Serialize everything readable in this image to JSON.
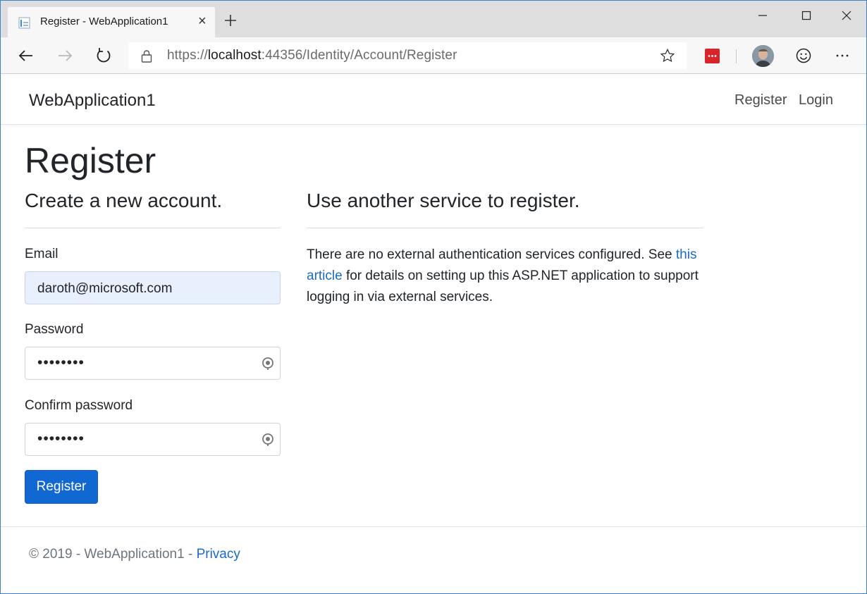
{
  "browser": {
    "tab_title": "Register - WebApplication1",
    "url_prefix": "https://",
    "url_host": "localhost",
    "url_path": ":44356/Identity/Account/Register"
  },
  "header": {
    "brand": "WebApplication1",
    "nav": {
      "register": "Register",
      "login": "Login"
    }
  },
  "main": {
    "title": "Register",
    "form": {
      "heading": "Create a new account.",
      "email_label": "Email",
      "email_value": "daroth@microsoft.com",
      "password_label": "Password",
      "password_value": "••••••••",
      "confirm_label": "Confirm password",
      "confirm_value": "••••••••",
      "submit_label": "Register"
    },
    "external": {
      "heading": "Use another service to register.",
      "text_before": "There are no external authentication services configured. See ",
      "link_text": "this article",
      "text_after": " for details on setting up this ASP.NET application to support logging in via external services."
    }
  },
  "footer": {
    "copyright": "© 2019 - WebApplication1 - ",
    "privacy_link": "Privacy"
  },
  "colors": {
    "primary_button": "#1268d3",
    "link": "#1a6bc7",
    "autofill_bg": "#e8f0fe",
    "extension_red": "#d9252a"
  }
}
